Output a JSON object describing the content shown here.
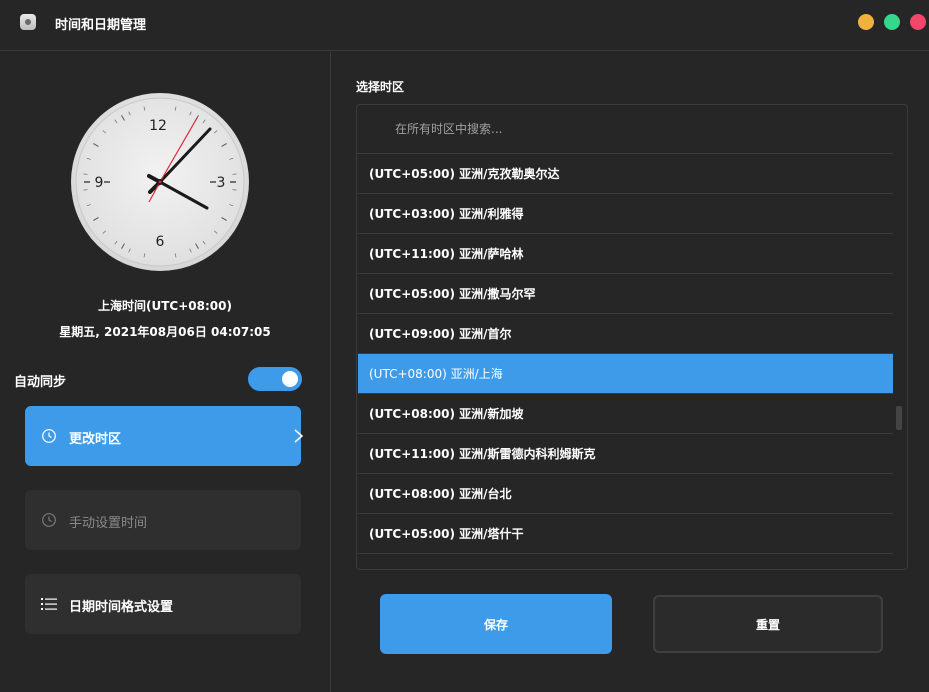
{
  "window": {
    "title": "时间和日期管理"
  },
  "clock": {
    "numerals": [
      "12",
      "3",
      "6",
      "9"
    ],
    "timezone_label": "上海时间(UTC+08:00)",
    "datetime": "星期五, 2021年08月06日 04:07:05"
  },
  "auto_sync": {
    "label": "自动同步",
    "enabled": true
  },
  "sidebar": {
    "change_tz": {
      "label": "更改时区",
      "icon": "clock-icon"
    },
    "manual_time": {
      "label": "手动设置时间",
      "icon": "clock-icon"
    },
    "format": {
      "label": "日期时间格式设置",
      "icon": "list-icon"
    }
  },
  "timezone_panel": {
    "title": "选择时区",
    "search_placeholder": "在所有时区中搜索...",
    "rows": [
      "(UTC+05:00) 亚洲/克孜勒奥尔达",
      "(UTC+03:00) 亚洲/利雅得",
      "(UTC+11:00) 亚洲/萨哈林",
      "(UTC+05:00) 亚洲/撒马尔罕",
      "(UTC+09:00) 亚洲/首尔",
      "(UTC+08:00) 亚洲/上海",
      "(UTC+08:00) 亚洲/新加坡",
      "(UTC+11:00) 亚洲/斯雷德内科利姆斯克",
      "(UTC+08:00) 亚洲/台北",
      "(UTC+05:00) 亚洲/塔什干"
    ],
    "selected_index": 5
  },
  "actions": {
    "save": "保存",
    "reset": "重置"
  },
  "colors": {
    "accent": "#3d9bea",
    "background": "#262626",
    "minimize": "#f0b23c",
    "maximize": "#36d68c",
    "close": "#f2476b",
    "second_hand": "#e0283a"
  }
}
